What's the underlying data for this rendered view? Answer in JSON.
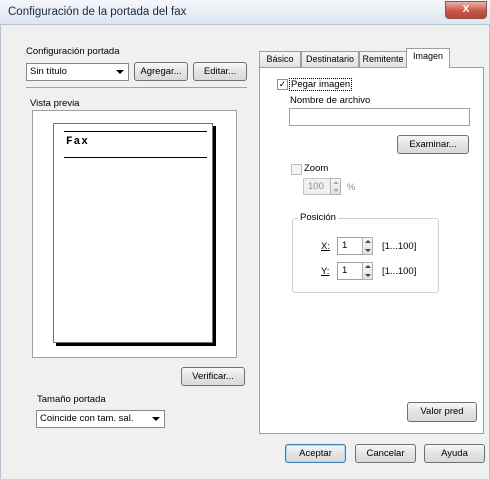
{
  "window": {
    "title": "Configuración de la portada del fax",
    "close_glyph": "X"
  },
  "cover_config": {
    "label": "Configuración portada",
    "selected": "Sin título",
    "add_button": "Agregar...",
    "edit_button": "Editar..."
  },
  "preview": {
    "label": "Vista previa",
    "page_title": "Fax",
    "verify_button": "Verificar..."
  },
  "cover_size": {
    "label": "Tamaño portada",
    "selected": "Coincide con tam. sal."
  },
  "tabs": [
    {
      "label": "Básico",
      "active": false
    },
    {
      "label": "Destinatario",
      "active": false
    },
    {
      "label": "Remitente",
      "active": false
    },
    {
      "label": "Imagen",
      "active": true
    }
  ],
  "image_tab": {
    "paste_image": {
      "label": "Pegar imagen",
      "checked": true
    },
    "file_name": {
      "label": "Nombre de archivo",
      "value": ""
    },
    "browse_button": "Examinar...",
    "zoom": {
      "label": "Zoom",
      "checked": false,
      "value": "100",
      "unit": "%"
    },
    "position": {
      "label": "Posición",
      "x": {
        "label": "X:",
        "value": "1",
        "range": "[1...100]"
      },
      "y": {
        "label": "Y:",
        "value": "1",
        "range": "[1...100]"
      }
    },
    "default_button": "Valor pred"
  },
  "footer": {
    "ok_button": "Aceptar",
    "cancel_button": "Cancelar",
    "help_button": "Ayuda"
  }
}
